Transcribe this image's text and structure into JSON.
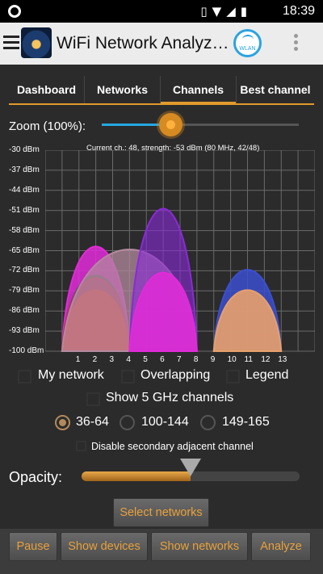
{
  "status_bar": {
    "time": "18:39",
    "icons": [
      "vibrate-icon",
      "wifi-icon",
      "signal-icon",
      "battery-icon"
    ]
  },
  "app_bar": {
    "title": "WiFi Network Analyz…",
    "wlan_badge": "WLAN"
  },
  "tabs": [
    {
      "label": "Dashboard",
      "active": false
    },
    {
      "label": "Networks",
      "active": false
    },
    {
      "label": "Channels",
      "active": true
    },
    {
      "label": "Best channel",
      "active": false
    }
  ],
  "zoom": {
    "label": "Zoom (100%):",
    "value_percent": 35
  },
  "chart_info": "Current ch.: 48, strength: -53 dBm (80 MHz, 42/48)",
  "chart_data": {
    "type": "area",
    "y_unit": "dBm",
    "y_ticks": [
      "-30 dBm",
      "-37 dBm",
      "-44 dBm",
      "-51 dBm",
      "-58 dBm",
      "-65 dBm",
      "-72 dBm",
      "-79 dBm",
      "-86 dBm",
      "-93 dBm",
      "-100 dBm"
    ],
    "ylim": [
      -100,
      -30
    ],
    "x_ticks": [
      "1",
      "2",
      "3",
      "4",
      "5",
      "6",
      "7",
      "8",
      "9",
      "10",
      "11",
      "12",
      "13"
    ],
    "xlim": [
      -1,
      15
    ],
    "networks": [
      {
        "center": 2,
        "halfwidth": 2,
        "peak": -64,
        "color": "#e22ad8",
        "opacity": 0.85
      },
      {
        "center": 2,
        "halfwidth": 2,
        "peak": -74,
        "color": "#555555",
        "opacity": 0.85
      },
      {
        "center": 2,
        "halfwidth": 2,
        "peak": -75,
        "color": "#d1235e",
        "opacity": 0.7
      },
      {
        "center": 2,
        "halfwidth": 2,
        "peak": -79,
        "color": "#ee3a2a",
        "opacity": 0.9
      },
      {
        "center": 4,
        "halfwidth": 4,
        "peak": -65,
        "color": "#b38a9e",
        "opacity": 0.75
      },
      {
        "center": 6,
        "halfwidth": 2,
        "peak": -51,
        "color": "#8a2ad8",
        "opacity": 0.6
      },
      {
        "center": 6,
        "halfwidth": 2,
        "peak": -73,
        "color": "#e22ad8",
        "opacity": 0.85
      },
      {
        "center": 11,
        "halfwidth": 2,
        "peak": -72,
        "color": "#3b4fcf",
        "opacity": 0.85
      },
      {
        "center": 11,
        "halfwidth": 2,
        "peak": -79,
        "color": "#e8a06a",
        "opacity": 0.9
      }
    ],
    "grid": true
  },
  "checkboxes": {
    "my_network": "My network",
    "overlapping": "Overlapping",
    "legend": "Legend",
    "show_5ghz": "Show 5 GHz channels",
    "disable_secondary": "Disable secondary adjacent channel"
  },
  "channel_ranges": [
    {
      "label": "36-64",
      "selected": true
    },
    {
      "label": "100-144",
      "selected": false
    },
    {
      "label": "149-165",
      "selected": false
    }
  ],
  "opacity": {
    "label": "Opacity:",
    "value_fraction": 0.5
  },
  "buttons": {
    "select_networks": "Select networks",
    "pause": "Pause",
    "show_devices": "Show devices",
    "show_networks": "Show networks",
    "analyze": "Analyze"
  },
  "colors": {
    "accent": "#e29a2c",
    "zoom_blue": "#25a7e0"
  }
}
